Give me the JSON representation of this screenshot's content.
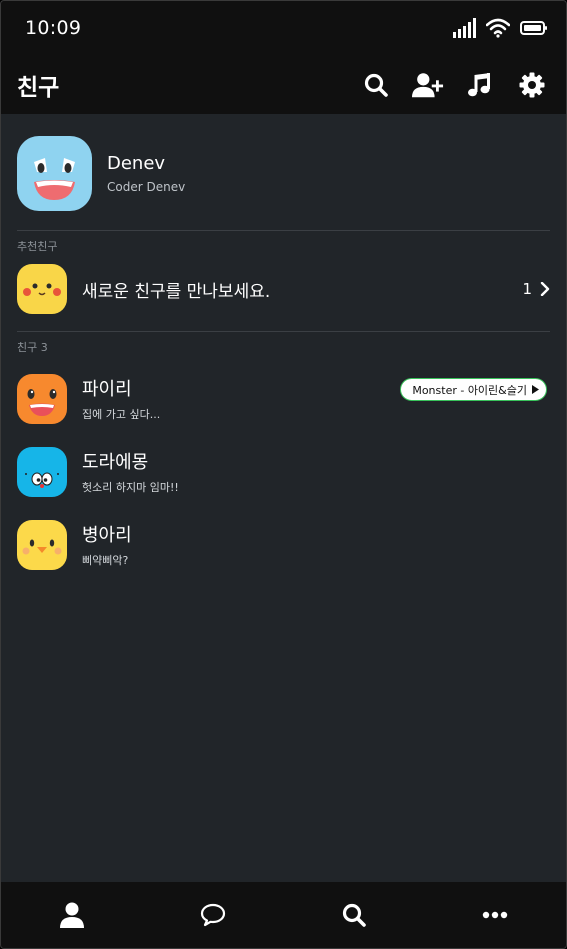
{
  "status_bar": {
    "time": "10:09"
  },
  "header": {
    "title": "친구",
    "actions": [
      "search-icon",
      "add-friend-icon",
      "music-icon",
      "gear-icon"
    ]
  },
  "profile": {
    "name": "Denev",
    "status": "Coder Denev"
  },
  "recommend": {
    "label": "추천친구",
    "text": "새로운 친구를 만나보세요.",
    "count": "1"
  },
  "friends": {
    "label": "친구 3",
    "items": [
      {
        "name": "파이리",
        "status": "집에 가고 싶다...",
        "music": "Monster - 아이린&슬기"
      },
      {
        "name": "도라에몽",
        "status": "헛소리 하지마 임마!!"
      },
      {
        "name": "병아리",
        "status": "삐약삐악?"
      }
    ]
  },
  "bottom_nav": [
    "person-icon",
    "chat-icon",
    "search-icon",
    "more-icon"
  ],
  "colors": {
    "background": "#212529",
    "bars": "#101010",
    "badge_border": "#38c25a"
  }
}
